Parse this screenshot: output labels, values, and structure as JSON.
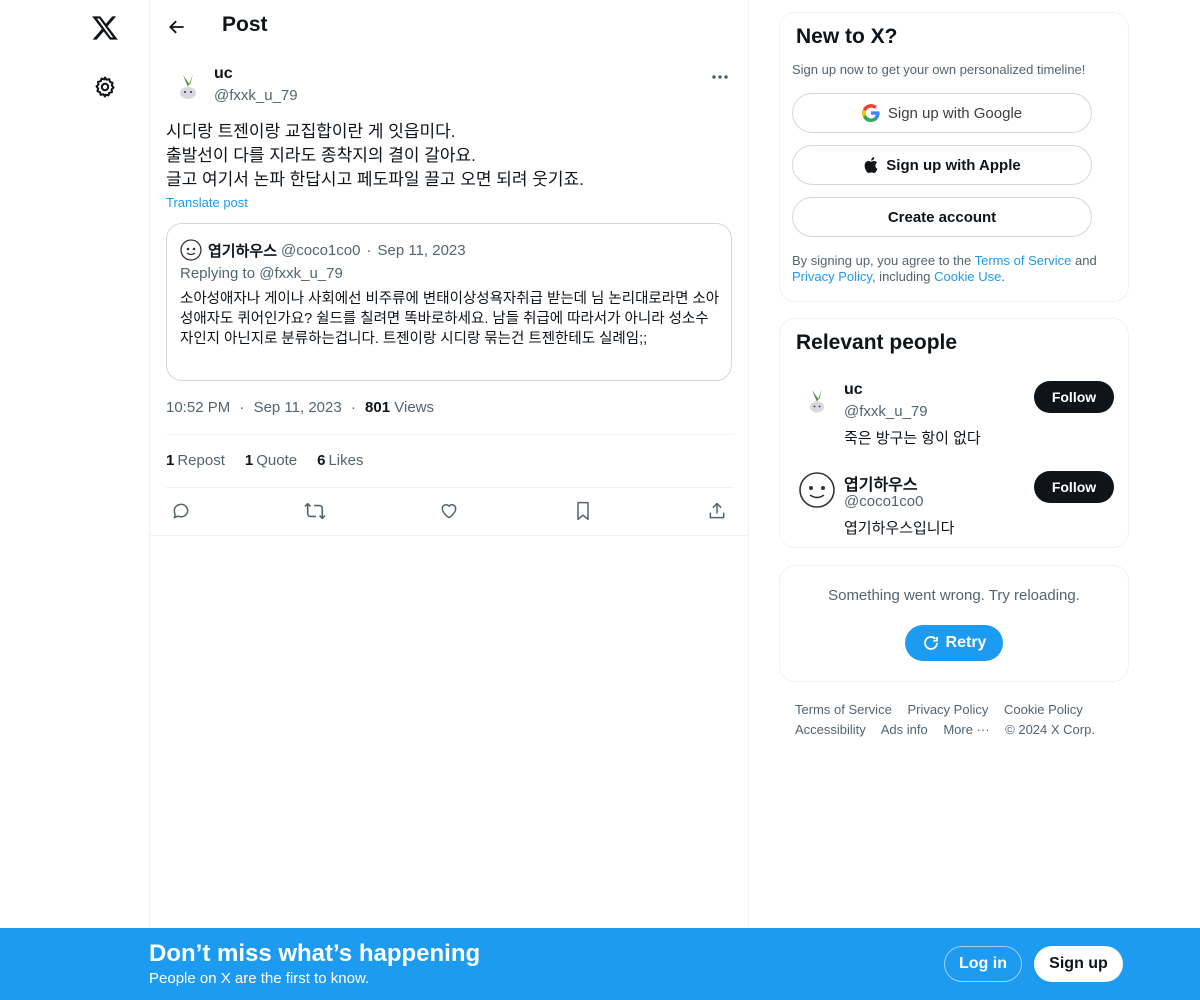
{
  "nav": {
    "logo_icon": "x-logo-icon",
    "settings_icon": "gear-icon"
  },
  "header": {
    "title": "Post"
  },
  "post": {
    "author_name": "uc",
    "author_handle": "@fxxk_u_79",
    "lines": [
      "시디랑 트젠이랑 교집합이란 게 잇읍미다.",
      "출발선이 다를 지라도 종착지의 결이 갈아요.",
      "글고 여기서 논파 한답시고 페도파일 끌고 오면 되려 웃기죠."
    ],
    "translate_label": "Translate post",
    "quote": {
      "name": "엽기하우스",
      "handle": "@coco1co0",
      "separator": "·",
      "date": "Sep 11, 2023",
      "replying": "Replying to @fxxk_u_79",
      "text": "소아성애자나 게이나 사회에선 비주류에 변태이상성욕자취급 받는데 님 논리대로라면 소아성애자도 퀴어인가요? 쉴드를 칠려면 똑바로하세요. 남들 취급에 따라서가 아니라 성소수자인지 아닌지로 분류하는겁니다. 트젠이랑 시디랑 묶는건 트젠한테도 실례임;;"
    },
    "time": "10:52 PM",
    "date": "Sep 11, 2023",
    "views_count": "801",
    "views_label": "Views",
    "dot": "·",
    "reposts_count": "1",
    "reposts_label": "Repost",
    "quotes_count": "1",
    "quotes_label": "Quote",
    "likes_count": "6",
    "likes_label": "Likes"
  },
  "signup_card": {
    "title": "New to X?",
    "subtitle": "Sign up now to get your own personalized timeline!",
    "google_label": "Sign up with Google",
    "apple_label": "Sign up with Apple",
    "create_label": "Create account",
    "legal_prefix": "By signing up, you agree to the ",
    "terms_link": "Terms of Service",
    "legal_and": " and ",
    "privacy_link": "Privacy Policy",
    "legal_including": ", including ",
    "cookie_link": "Cookie Use",
    "legal_end": "."
  },
  "people_card": {
    "title": "Relevant people",
    "people": [
      {
        "name": "uc",
        "handle": "@fxxk_u_79",
        "bio": "죽은 방구는 항이 없다",
        "button": "Follow"
      },
      {
        "name": "엽기하우스",
        "handle": "@coco1co0",
        "bio": "엽기하우스입니다",
        "button": "Follow"
      }
    ]
  },
  "error_card": {
    "message": "Something went wrong. Try reloading.",
    "retry_label": "Retry"
  },
  "footer": {
    "links": [
      "Terms of Service",
      "Privacy Policy",
      "Cookie Policy",
      "Accessibility",
      "Ads info",
      "More ···",
      "© 2024 X Corp."
    ]
  },
  "banner": {
    "title": "Don’t miss what’s happening",
    "subtitle": "People on X are the first to know.",
    "login_label": "Log in",
    "signup_label": "Sign up"
  },
  "colors": {
    "accent": "#1d9bf0",
    "text": "#0f1419",
    "muted": "#536471",
    "border": "#eff3f4"
  }
}
